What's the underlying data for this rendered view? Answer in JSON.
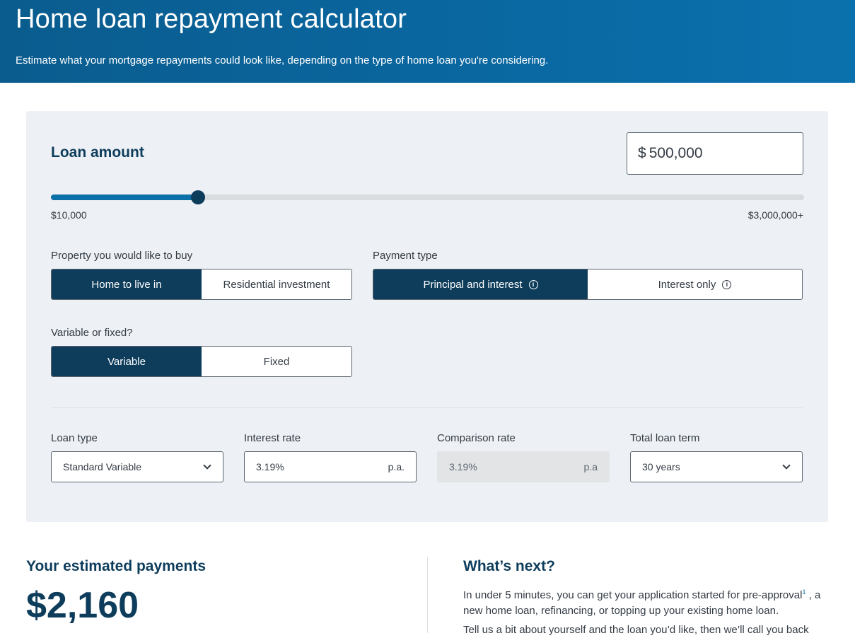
{
  "header": {
    "title": "Home loan repayment calculator",
    "subtitle": "Estimate what your mortgage repayments could look like, depending on the type of home loan you're considering."
  },
  "loan": {
    "label": "Loan amount",
    "currency": "$",
    "value": "500,000",
    "slider_min": "$10,000",
    "slider_max": "$3,000,000+",
    "slider_fraction": 0.195
  },
  "property": {
    "label": "Property you would like to buy",
    "options": [
      "Home to live in",
      "Residential investment"
    ],
    "selected": "Home to live in"
  },
  "payment_type": {
    "label": "Payment type",
    "options": [
      "Principal and interest",
      "Interest only"
    ],
    "selected": "Principal and interest"
  },
  "rate_type": {
    "label": "Variable or fixed?",
    "options": [
      "Variable",
      "Fixed"
    ],
    "selected": "Variable"
  },
  "fields": {
    "loan_type": {
      "label": "Loan type",
      "value": "Standard Variable"
    },
    "interest_rate": {
      "label": "Interest rate",
      "value": "3.19%",
      "suffix": "p.a."
    },
    "comparison_rate": {
      "label": "Comparison rate",
      "value": "3.19%",
      "suffix": "p.a"
    },
    "loan_term": {
      "label": "Total loan term",
      "value": "30 years"
    }
  },
  "estimate": {
    "title": "Your estimated payments",
    "amount": "$2,160"
  },
  "next": {
    "title": "What’s next?",
    "p1_a": "In under 5 minutes, you can get your application started for pre-approval",
    "p1_sup": "1",
    "p1_b": " , a new home loan, refinancing, or topping up your existing home loan.",
    "p2": "Tell us a bit about yourself and the loan you’d like, then we’ll call you back"
  },
  "colors": {
    "header": "#0a67a0",
    "navy": "#0e3d5c",
    "accent": "#0b6fa8",
    "panel": "#edf0f4"
  }
}
